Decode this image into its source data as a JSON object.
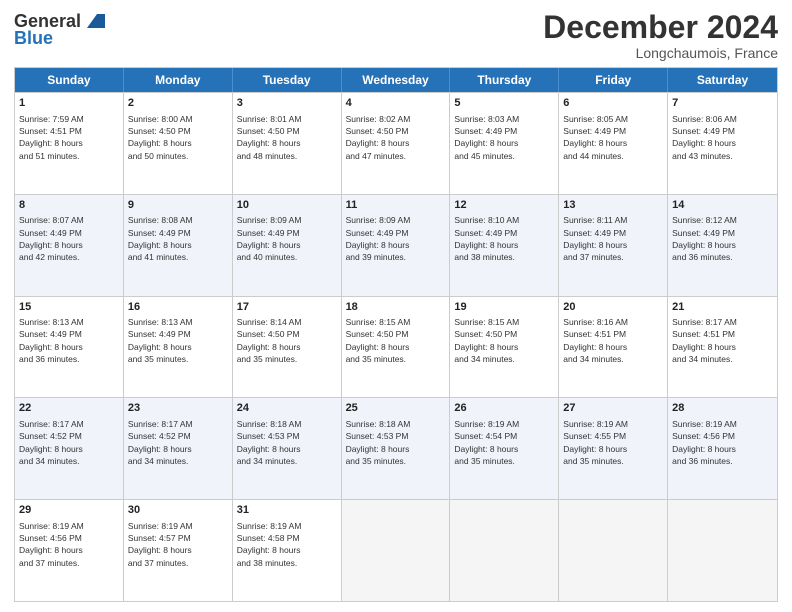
{
  "logo": {
    "general": "General",
    "blue": "Blue"
  },
  "header": {
    "month": "December 2024",
    "location": "Longchaumois, France"
  },
  "weekdays": [
    "Sunday",
    "Monday",
    "Tuesday",
    "Wednesday",
    "Thursday",
    "Friday",
    "Saturday"
  ],
  "rows": [
    [
      {
        "day": "1",
        "lines": [
          "Sunrise: 7:59 AM",
          "Sunset: 4:51 PM",
          "Daylight: 8 hours",
          "and 51 minutes."
        ]
      },
      {
        "day": "2",
        "lines": [
          "Sunrise: 8:00 AM",
          "Sunset: 4:50 PM",
          "Daylight: 8 hours",
          "and 50 minutes."
        ]
      },
      {
        "day": "3",
        "lines": [
          "Sunrise: 8:01 AM",
          "Sunset: 4:50 PM",
          "Daylight: 8 hours",
          "and 48 minutes."
        ]
      },
      {
        "day": "4",
        "lines": [
          "Sunrise: 8:02 AM",
          "Sunset: 4:50 PM",
          "Daylight: 8 hours",
          "and 47 minutes."
        ]
      },
      {
        "day": "5",
        "lines": [
          "Sunrise: 8:03 AM",
          "Sunset: 4:49 PM",
          "Daylight: 8 hours",
          "and 45 minutes."
        ]
      },
      {
        "day": "6",
        "lines": [
          "Sunrise: 8:05 AM",
          "Sunset: 4:49 PM",
          "Daylight: 8 hours",
          "and 44 minutes."
        ]
      },
      {
        "day": "7",
        "lines": [
          "Sunrise: 8:06 AM",
          "Sunset: 4:49 PM",
          "Daylight: 8 hours",
          "and 43 minutes."
        ]
      }
    ],
    [
      {
        "day": "8",
        "lines": [
          "Sunrise: 8:07 AM",
          "Sunset: 4:49 PM",
          "Daylight: 8 hours",
          "and 42 minutes."
        ]
      },
      {
        "day": "9",
        "lines": [
          "Sunrise: 8:08 AM",
          "Sunset: 4:49 PM",
          "Daylight: 8 hours",
          "and 41 minutes."
        ]
      },
      {
        "day": "10",
        "lines": [
          "Sunrise: 8:09 AM",
          "Sunset: 4:49 PM",
          "Daylight: 8 hours",
          "and 40 minutes."
        ]
      },
      {
        "day": "11",
        "lines": [
          "Sunrise: 8:09 AM",
          "Sunset: 4:49 PM",
          "Daylight: 8 hours",
          "and 39 minutes."
        ]
      },
      {
        "day": "12",
        "lines": [
          "Sunrise: 8:10 AM",
          "Sunset: 4:49 PM",
          "Daylight: 8 hours",
          "and 38 minutes."
        ]
      },
      {
        "day": "13",
        "lines": [
          "Sunrise: 8:11 AM",
          "Sunset: 4:49 PM",
          "Daylight: 8 hours",
          "and 37 minutes."
        ]
      },
      {
        "day": "14",
        "lines": [
          "Sunrise: 8:12 AM",
          "Sunset: 4:49 PM",
          "Daylight: 8 hours",
          "and 36 minutes."
        ]
      }
    ],
    [
      {
        "day": "15",
        "lines": [
          "Sunrise: 8:13 AM",
          "Sunset: 4:49 PM",
          "Daylight: 8 hours",
          "and 36 minutes."
        ]
      },
      {
        "day": "16",
        "lines": [
          "Sunrise: 8:13 AM",
          "Sunset: 4:49 PM",
          "Daylight: 8 hours",
          "and 35 minutes."
        ]
      },
      {
        "day": "17",
        "lines": [
          "Sunrise: 8:14 AM",
          "Sunset: 4:50 PM",
          "Daylight: 8 hours",
          "and 35 minutes."
        ]
      },
      {
        "day": "18",
        "lines": [
          "Sunrise: 8:15 AM",
          "Sunset: 4:50 PM",
          "Daylight: 8 hours",
          "and 35 minutes."
        ]
      },
      {
        "day": "19",
        "lines": [
          "Sunrise: 8:15 AM",
          "Sunset: 4:50 PM",
          "Daylight: 8 hours",
          "and 34 minutes."
        ]
      },
      {
        "day": "20",
        "lines": [
          "Sunrise: 8:16 AM",
          "Sunset: 4:51 PM",
          "Daylight: 8 hours",
          "and 34 minutes."
        ]
      },
      {
        "day": "21",
        "lines": [
          "Sunrise: 8:17 AM",
          "Sunset: 4:51 PM",
          "Daylight: 8 hours",
          "and 34 minutes."
        ]
      }
    ],
    [
      {
        "day": "22",
        "lines": [
          "Sunrise: 8:17 AM",
          "Sunset: 4:52 PM",
          "Daylight: 8 hours",
          "and 34 minutes."
        ]
      },
      {
        "day": "23",
        "lines": [
          "Sunrise: 8:17 AM",
          "Sunset: 4:52 PM",
          "Daylight: 8 hours",
          "and 34 minutes."
        ]
      },
      {
        "day": "24",
        "lines": [
          "Sunrise: 8:18 AM",
          "Sunset: 4:53 PM",
          "Daylight: 8 hours",
          "and 34 minutes."
        ]
      },
      {
        "day": "25",
        "lines": [
          "Sunrise: 8:18 AM",
          "Sunset: 4:53 PM",
          "Daylight: 8 hours",
          "and 35 minutes."
        ]
      },
      {
        "day": "26",
        "lines": [
          "Sunrise: 8:19 AM",
          "Sunset: 4:54 PM",
          "Daylight: 8 hours",
          "and 35 minutes."
        ]
      },
      {
        "day": "27",
        "lines": [
          "Sunrise: 8:19 AM",
          "Sunset: 4:55 PM",
          "Daylight: 8 hours",
          "and 35 minutes."
        ]
      },
      {
        "day": "28",
        "lines": [
          "Sunrise: 8:19 AM",
          "Sunset: 4:56 PM",
          "Daylight: 8 hours",
          "and 36 minutes."
        ]
      }
    ],
    [
      {
        "day": "29",
        "lines": [
          "Sunrise: 8:19 AM",
          "Sunset: 4:56 PM",
          "Daylight: 8 hours",
          "and 37 minutes."
        ]
      },
      {
        "day": "30",
        "lines": [
          "Sunrise: 8:19 AM",
          "Sunset: 4:57 PM",
          "Daylight: 8 hours",
          "and 37 minutes."
        ]
      },
      {
        "day": "31",
        "lines": [
          "Sunrise: 8:19 AM",
          "Sunset: 4:58 PM",
          "Daylight: 8 hours",
          "and 38 minutes."
        ]
      },
      {
        "day": "",
        "lines": []
      },
      {
        "day": "",
        "lines": []
      },
      {
        "day": "",
        "lines": []
      },
      {
        "day": "",
        "lines": []
      }
    ]
  ]
}
